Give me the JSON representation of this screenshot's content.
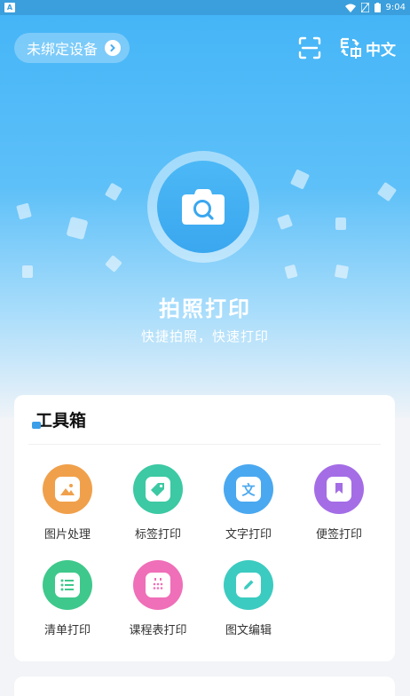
{
  "status_bar": {
    "left_icon": "A",
    "time": "9:04",
    "icons": [
      "wifi-icon",
      "no-sim-icon",
      "battery-icon"
    ]
  },
  "header": {
    "device_status": "未绑定设备",
    "scan_icon": "scan-icon",
    "language_label": "中文",
    "language_icon": "translate-icon"
  },
  "hero": {
    "title": "拍照打印",
    "subtitle": "快捷拍照，快速打印",
    "icon": "camera-icon"
  },
  "toolbox": {
    "title": "工具箱",
    "tools": [
      {
        "label": "图片处理",
        "icon": "image-icon",
        "color": "#f0a04b"
      },
      {
        "label": "标签打印",
        "icon": "tag-icon",
        "color": "#3cc9a3"
      },
      {
        "label": "文字打印",
        "icon": "text-icon",
        "color": "#4aa8f0"
      },
      {
        "label": "便签打印",
        "icon": "bookmark-icon",
        "color": "#a46de6"
      },
      {
        "label": "清单打印",
        "icon": "list-icon",
        "color": "#3fc88b"
      },
      {
        "label": "课程表打印",
        "icon": "calendar-icon",
        "color": "#ef6fb8"
      },
      {
        "label": "图文编辑",
        "icon": "edit-icon",
        "color": "#3ccbc0"
      }
    ]
  },
  "colors": {
    "accent": "#43b4f7",
    "statusbar": "#3a9fdc"
  }
}
